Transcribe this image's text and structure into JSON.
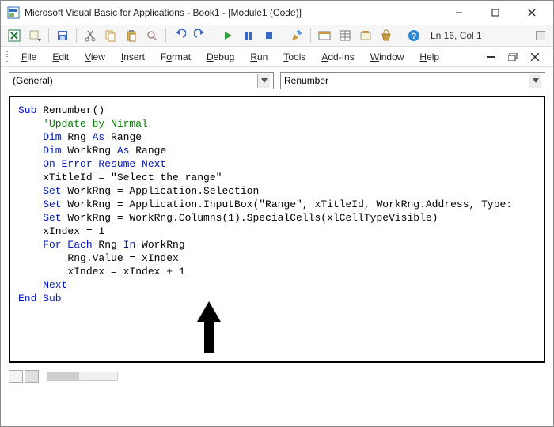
{
  "window": {
    "title": "Microsoft Visual Basic for Applications - Book1 - [Module1 (Code)]"
  },
  "status": {
    "cursor": "Ln 16, Col 1"
  },
  "menus": {
    "file": "File",
    "edit": "Edit",
    "view": "View",
    "insert": "Insert",
    "format": "Format",
    "debug": "Debug",
    "run": "Run",
    "tools": "Tools",
    "addins": "Add-Ins",
    "window": "Window",
    "help": "Help"
  },
  "dropdowns": {
    "object": "(General)",
    "proc": "Renumber"
  },
  "code": {
    "l1a": "Sub",
    "l1b": " Renumber()",
    "l2": "    'Update by Nirmal",
    "l3a": "    Dim",
    "l3b": " Rng ",
    "l3c": "As",
    "l3d": " Range",
    "l4a": "    Dim",
    "l4b": " WorkRng ",
    "l4c": "As",
    "l4d": " Range",
    "l5": "    On Error Resume Next",
    "l6": "    xTitleId = \"Select the range\"",
    "l7a": "    Set",
    "l7b": " WorkRng = Application.Selection",
    "l8a": "    Set",
    "l8b": " WorkRng = Application.InputBox(\"Range\", xTitleId, WorkRng.Address, Type:",
    "l9a": "    Set",
    "l9b": " WorkRng = WorkRng.Columns(1).SpecialCells(xlCellTypeVisible)",
    "l10": "    xIndex = 1",
    "l11a": "    For Each",
    "l11b": " Rng ",
    "l11c": "In",
    "l11d": " WorkRng",
    "l12": "        Rng.Value = xIndex",
    "l13": "        xIndex = xIndex + 1",
    "l14": "    Next",
    "l15": "End Sub"
  }
}
